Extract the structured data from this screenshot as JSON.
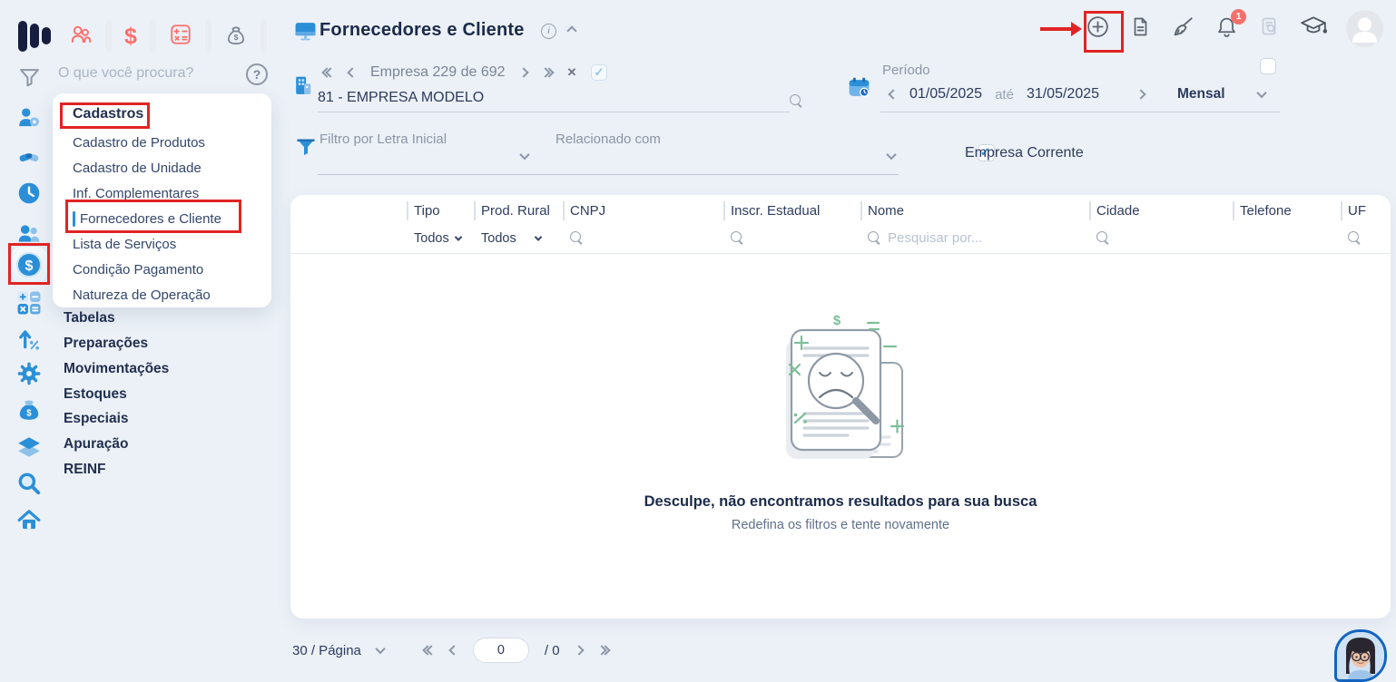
{
  "topbar": {
    "notification_count": "1"
  },
  "sidebar": {
    "search_placeholder": "O que você procura?",
    "menu": {
      "group_label": "Cadastros",
      "items": [
        "Cadastro de Produtos",
        "Cadastro de Unidade",
        "Inf. Complementares",
        "Fornecedores e Cliente",
        "Lista de Serviços",
        "Condição Pagamento",
        "Natureza de Operação"
      ],
      "active_item": "Fornecedores e Cliente"
    },
    "sections": [
      "Tabelas",
      "Preparações",
      "Movimentações",
      "Estoques",
      "Especiais",
      "Apuração",
      "REINF"
    ]
  },
  "header": {
    "title": "Fornecedores e Cliente",
    "company_nav": {
      "position": "Empresa 229 de 692",
      "company": "81 - EMPRESA MODELO"
    },
    "period": {
      "label": "Período",
      "start": "01/05/2025",
      "until": "até",
      "end": "31/05/2025",
      "mode": "Mensal"
    }
  },
  "filters": {
    "letter_label": "Filtro por Letra Inicial",
    "related_label": "Relacionado com",
    "current_company": "Empresa Corrente"
  },
  "table": {
    "columns": [
      "Tipo",
      "Prod. Rural",
      "CNPJ",
      "Inscr. Estadual",
      "Nome",
      "Cidade",
      "Telefone",
      "UF"
    ],
    "filter_row": {
      "tipo": "Todos",
      "prod_rural": "Todos",
      "nome_placeholder": "Pesquisar por..."
    },
    "empty": {
      "title": "Desculpe, não encontramos resultados para sua busca",
      "subtitle": "Redefina os filtros e tente novamente"
    }
  },
  "pagination": {
    "per_page": "30 / Página",
    "page": "0",
    "total": "/ 0"
  },
  "colors": {
    "accent_blue": "#2b8fd8",
    "brand_navy": "#161d3f",
    "icon_red": "#f9716d",
    "annotation_red": "#e02424",
    "empty_green": "#7cbf9a",
    "badge_red": "#f4716b"
  }
}
